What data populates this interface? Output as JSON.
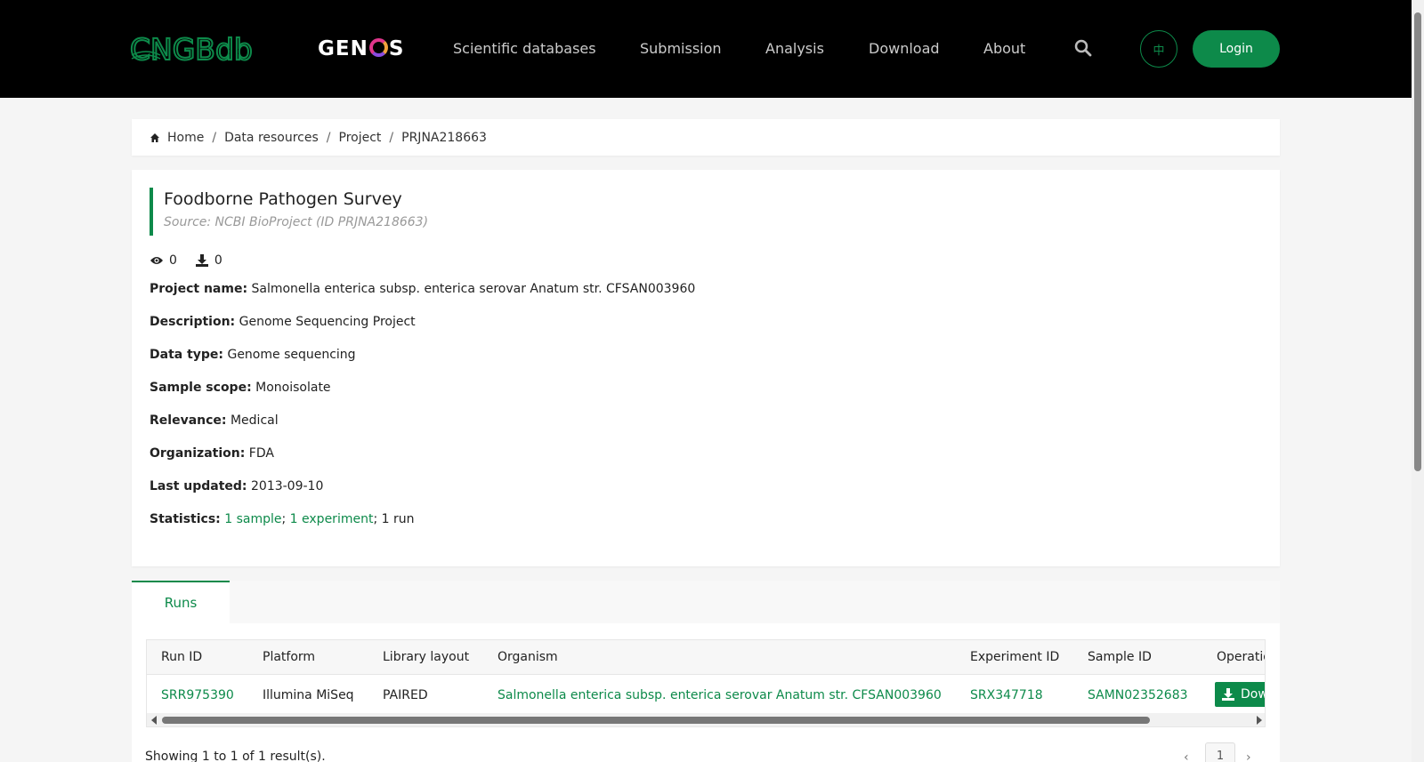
{
  "header": {
    "logo_cngb": "CNGBdb",
    "logo_genos": {
      "pre": "GEN",
      "post": "S"
    },
    "nav": [
      {
        "label": "Scientific databases"
      },
      {
        "label": "Submission"
      },
      {
        "label": "Analysis"
      },
      {
        "label": "Download"
      },
      {
        "label": "About"
      }
    ],
    "lang_label": "中",
    "login_label": "Login",
    "brand_color": "#0d8a4a"
  },
  "breadcrumb": [
    {
      "label": "Home"
    },
    {
      "label": "Data resources"
    },
    {
      "label": "Project"
    },
    {
      "label": "PRJNA218663"
    }
  ],
  "project": {
    "title": "Foodborne Pathogen Survey",
    "source": "Source: NCBI BioProject (ID PRJNA218663)",
    "views": "0",
    "downloads": "0",
    "fields": [
      {
        "label": "Project name:",
        "value": "Salmonella enterica subsp. enterica serovar Anatum str. CFSAN003960"
      },
      {
        "label": "Description:",
        "value": "Genome Sequencing Project"
      },
      {
        "label": "Data type:",
        "value": "Genome sequencing"
      },
      {
        "label": "Sample scope:",
        "value": "Monoisolate"
      },
      {
        "label": "Relevance:",
        "value": "Medical"
      },
      {
        "label": "Organization:",
        "value": "FDA"
      },
      {
        "label": "Last updated:",
        "value": "2013-09-10"
      }
    ],
    "statistics": {
      "label": "Statistics:",
      "sample_link": "1 sample",
      "sep1": ";",
      "experiment_link": "1 experiment",
      "rest": "; 1 run"
    }
  },
  "tabs": [
    {
      "label": "Runs"
    }
  ],
  "runs_table": {
    "columns": [
      "Run ID",
      "Platform",
      "Library layout",
      "Organism",
      "Experiment ID",
      "Sample ID",
      "Operation"
    ],
    "rows": [
      {
        "run_id": "SRR975390",
        "platform": "Illumina MiSeq",
        "layout": "PAIRED",
        "organism": "Salmonella enterica subsp. enterica serovar Anatum str. CFSAN003960",
        "experiment_id": "SRX347718",
        "sample_id": "SAMN02352683",
        "operation": "Download"
      }
    ]
  },
  "pagination": {
    "summary": "Showing 1 to 1 of 1 result(s).",
    "current_page": "1",
    "prev": "‹",
    "next": "›"
  }
}
